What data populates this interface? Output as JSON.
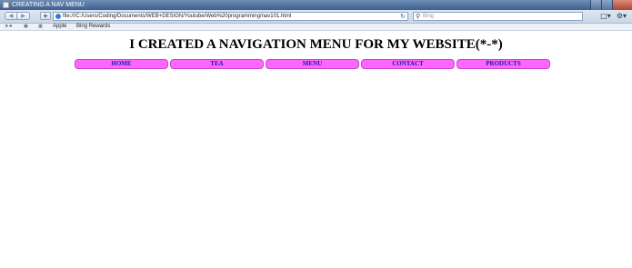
{
  "window": {
    "title": "CREATING A NAV MENU"
  },
  "toolbar": {
    "back_icon": "arrow-left-icon",
    "forward_icon": "arrow-right-icon",
    "new_tab_label": "+",
    "address_url": "file:///C:/Users/Coding/Documents/WEB+DESIGN/Youtube/Web%20programming/nav101.html",
    "search_placeholder": "Bing"
  },
  "favorites": {
    "links": [
      "Apple",
      "Bing Rewards"
    ]
  },
  "page": {
    "heading": "I CREATED A NAVIGATION MENU FOR MY WEBSITE(*-*)",
    "menu_items": [
      "HOME",
      "TEA",
      "MENU",
      "CONTACT",
      "PRODUCTS"
    ]
  },
  "colors": {
    "menu_background": "#ff66ff",
    "menu_text": "#1a1aa6",
    "titlebar": "#4f6f9c"
  }
}
